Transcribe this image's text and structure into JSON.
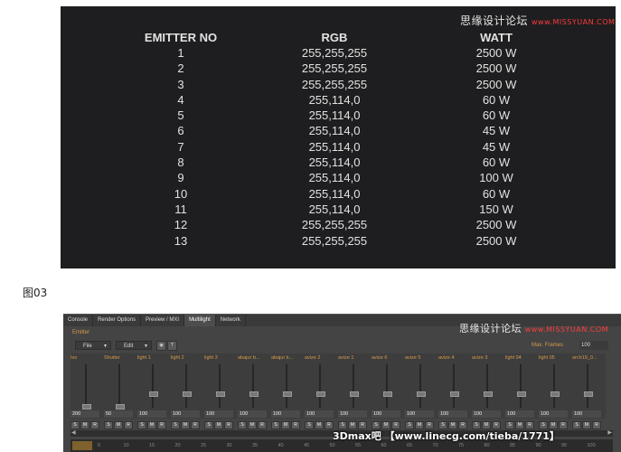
{
  "watermark": {
    "cn": "思缘设计论坛",
    "url": "www.MISSYUAN.COM"
  },
  "table": {
    "headers": {
      "emitter": "EMITTER NO",
      "rgb": "RGB",
      "watt": "WATT"
    },
    "rows": [
      {
        "no": "1",
        "rgb": "255,255,255",
        "watt": "2500 W"
      },
      {
        "no": "2",
        "rgb": "255,255,255",
        "watt": "2500 W"
      },
      {
        "no": "3",
        "rgb": "255,255,255",
        "watt": "2500 W"
      },
      {
        "no": "4",
        "rgb": "255,114,0",
        "watt": "60 W"
      },
      {
        "no": "5",
        "rgb": "255,114,0",
        "watt": "60 W"
      },
      {
        "no": "6",
        "rgb": "255,114,0",
        "watt": "45 W"
      },
      {
        "no": "7",
        "rgb": "255,114,0",
        "watt": "45 W"
      },
      {
        "no": "8",
        "rgb": "255,114,0",
        "watt": "60 W"
      },
      {
        "no": "9",
        "rgb": "255,114,0",
        "watt": "100 W"
      },
      {
        "no": "10",
        "rgb": "255,114,0",
        "watt": "60 W"
      },
      {
        "no": "11",
        "rgb": "255,114,0",
        "watt": "150 W"
      },
      {
        "no": "12",
        "rgb": "255,255,255",
        "watt": "2500 W"
      },
      {
        "no": "13",
        "rgb": "255,255,255",
        "watt": "2500 W"
      }
    ]
  },
  "caption": "图03",
  "window": {
    "tabs": [
      "Console",
      "Render Options",
      "Preview / MXI",
      "Multilight",
      "Network"
    ],
    "active_tab": "Multilight",
    "group_label": "Emitter",
    "file_menu": "File",
    "edit_menu": "Edit",
    "max_frames_label": "Max. Frames",
    "max_frames_value": "100",
    "channels": [
      {
        "name": "Iso",
        "value": "200",
        "level": 0.0
      },
      {
        "name": "Shutter",
        "value": "50",
        "level": 0.0
      },
      {
        "name": "light 1",
        "value": "100",
        "level": 0.3
      },
      {
        "name": "light 2",
        "value": "100",
        "level": 0.3
      },
      {
        "name": "light 3",
        "value": "100",
        "level": 0.3
      },
      {
        "name": "abajur b...",
        "value": "100",
        "level": 0.3
      },
      {
        "name": "abajur k...",
        "value": "100",
        "level": 0.3
      },
      {
        "name": "avize 2",
        "value": "100",
        "level": 0.3
      },
      {
        "name": "avize 1",
        "value": "100",
        "level": 0.3
      },
      {
        "name": "avize 6",
        "value": "100",
        "level": 0.3
      },
      {
        "name": "avize 5",
        "value": "100",
        "level": 0.3
      },
      {
        "name": "avize 4",
        "value": "100",
        "level": 0.3
      },
      {
        "name": "avize 3",
        "value": "100",
        "level": 0.3
      },
      {
        "name": "light 04",
        "value": "100",
        "level": 0.3
      },
      {
        "name": "light 05",
        "value": "100",
        "level": 0.3
      },
      {
        "name": "arch19_0...",
        "value": "100",
        "level": 0.3
      }
    ],
    "timeline_ticks": [
      "5",
      "10",
      "15",
      "20",
      "25",
      "30",
      "35",
      "40",
      "45",
      "50",
      "55",
      "60",
      "65",
      "70",
      "75",
      "80",
      "85",
      "90",
      "95",
      "100"
    ]
  },
  "footer_watermark": "3Dmax吧 【www.linecg.com/tieba/1771】"
}
